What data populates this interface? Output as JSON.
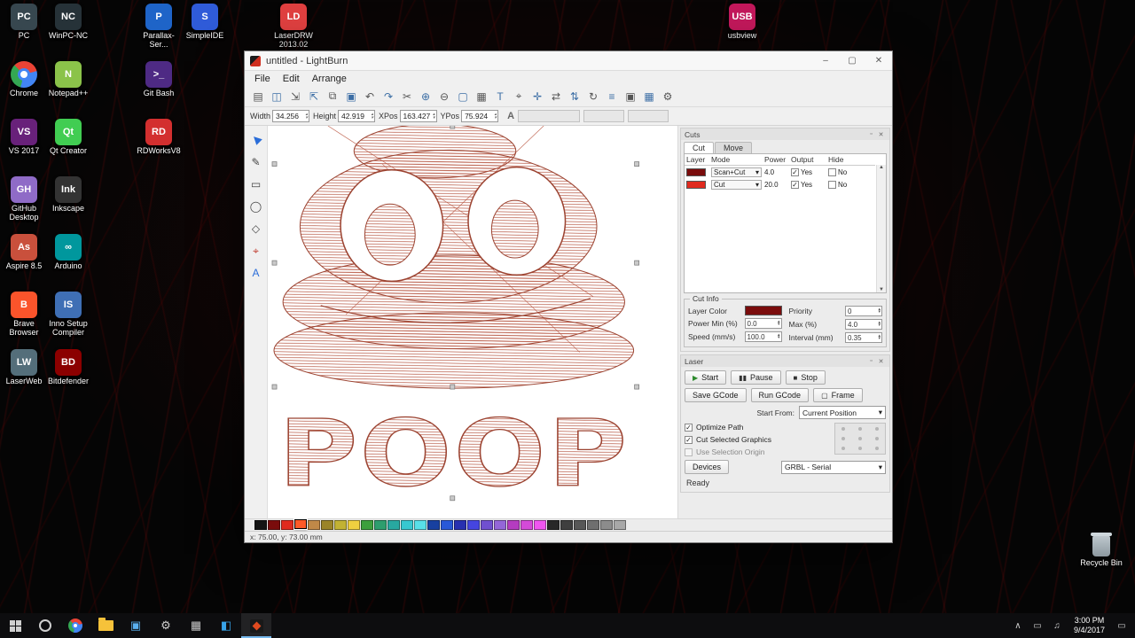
{
  "icons": {
    "chevron_down": "▾",
    "spin_up": "▴",
    "spin_down": "▾",
    "scroll_up": "▲",
    "scroll_down": "▼",
    "minimize": "–",
    "maximize": "▢",
    "close": "✕",
    "float": "▫"
  },
  "desktop": {
    "groups": [
      {
        "icons": [
          {
            "label": "PC",
            "abbr": "PC",
            "color": "#37474f"
          },
          {
            "label": "Chrome",
            "abbr": "",
            "color": "#e84335",
            "chrome": true
          },
          {
            "label": "VS 2017",
            "abbr": "VS",
            "color": "#68217a"
          },
          {
            "label": "GitHub Desktop",
            "abbr": "GH",
            "color": "#8f6bc7"
          },
          {
            "label": "Aspire 8.5",
            "abbr": "As",
            "color": "#c9503c"
          },
          {
            "label": "Brave Browser",
            "abbr": "B",
            "color": "#fb542b"
          },
          {
            "label": "LaserWeb",
            "abbr": "LW",
            "color": "#546e7a"
          }
        ]
      },
      {
        "icons": [
          {
            "label": "WinPC-NC",
            "abbr": "NC",
            "color": "#263238"
          },
          {
            "label": "Notepad++",
            "abbr": "N",
            "color": "#8bc34a"
          },
          {
            "label": "Qt Creator",
            "abbr": "Qt",
            "color": "#41cd52"
          },
          {
            "label": "Inkscape",
            "abbr": "Ink",
            "color": "#333333"
          },
          {
            "label": "Arduino",
            "abbr": "∞",
            "color": "#00979d"
          },
          {
            "label": "Inno Setup Compiler",
            "abbr": "IS",
            "color": "#3f6fb5"
          },
          {
            "label": "Bitdefender",
            "abbr": "BD",
            "color": "#8b0000"
          }
        ]
      },
      {
        "icons": [
          {
            "label": "Parallax-Ser...",
            "abbr": "P",
            "color": "#1e64c8"
          },
          {
            "label": "Git Bash",
            "abbr": ">_",
            "color": "#4e2a84"
          },
          {
            "label": "RDWorksV8",
            "abbr": "RD",
            "color": "#d32f2f"
          }
        ]
      },
      {
        "icons": [
          {
            "label": "SimpleIDE",
            "abbr": "S",
            "color": "#2f5bd8"
          }
        ]
      },
      {
        "icons": [
          {
            "label": "LaserDRW 2013.02",
            "abbr": "LD",
            "color": "#e04040"
          }
        ]
      },
      {
        "icons": [
          {
            "label": "usbview",
            "abbr": "USB",
            "color": "#c2185b"
          }
        ]
      }
    ],
    "recycle_bin_label": "Recycle Bin"
  },
  "window": {
    "title": "untitled - LightBurn",
    "menus": [
      "File",
      "Edit",
      "Arrange"
    ],
    "toolbar": [
      {
        "name": "open",
        "glyph": "▤"
      },
      {
        "name": "save",
        "glyph": "◫"
      },
      {
        "name": "import",
        "glyph": "⇲"
      },
      {
        "name": "export",
        "glyph": "⇱"
      },
      {
        "name": "copy",
        "glyph": "⧉"
      },
      {
        "name": "paste",
        "glyph": "▣"
      },
      {
        "name": "undo",
        "glyph": "↶"
      },
      {
        "name": "redo",
        "glyph": "↷"
      },
      {
        "name": "cut",
        "glyph": "✂"
      },
      {
        "name": "zoom-in",
        "glyph": "⊕"
      },
      {
        "name": "zoom-out",
        "glyph": "⊖"
      },
      {
        "name": "frame",
        "glyph": "▢"
      },
      {
        "name": "grid",
        "glyph": "▦"
      },
      {
        "name": "text",
        "glyph": "T"
      },
      {
        "name": "position-laser",
        "glyph": "⌖"
      },
      {
        "name": "move-machine",
        "glyph": "✛"
      },
      {
        "name": "mirror-h",
        "glyph": "⇄"
      },
      {
        "name": "mirror-v",
        "glyph": "⇅"
      },
      {
        "name": "rotate",
        "glyph": "↻"
      },
      {
        "name": "align",
        "glyph": "≡"
      },
      {
        "name": "group",
        "glyph": "▣"
      },
      {
        "name": "array",
        "glyph": "▦"
      },
      {
        "name": "settings",
        "glyph": "⚙"
      }
    ],
    "props": {
      "width_label": "Width",
      "width_value": "34.256",
      "height_label": "Height",
      "height_value": "42.919",
      "xpos_label": "XPos",
      "xpos_value": "163.427",
      "ypos_label": "YPos",
      "ypos_value": "75.924",
      "font_icon": "A"
    },
    "tools": [
      {
        "name": "select",
        "glyph": "▶",
        "color": "#2a6dd9",
        "rot": -135
      },
      {
        "name": "draw-lines",
        "glyph": "✎",
        "color": "#444",
        "rot": 0
      },
      {
        "name": "rectangle",
        "glyph": "▭",
        "color": "#444",
        "rot": 0
      },
      {
        "name": "ellipse",
        "glyph": "◯",
        "color": "#444",
        "rot": 0
      },
      {
        "name": "polygon",
        "glyph": "◇",
        "color": "#444",
        "rot": 0
      },
      {
        "name": "position-laser",
        "glyph": "⌖",
        "color": "#c0392b",
        "rot": 0
      },
      {
        "name": "text",
        "glyph": "A",
        "color": "#2a6dd9",
        "rot": 0
      }
    ],
    "cuts": {
      "title": "Cuts",
      "tabs": [
        "Cut",
        "Move"
      ],
      "columns": [
        "Layer",
        "Mode",
        "Power",
        "Output",
        "Hide"
      ],
      "layers": [
        {
          "color": "#7a0c0c",
          "mode": "Scan+Cut",
          "power": "4.0",
          "output_label": "Yes",
          "output_checked": true,
          "hide_label": "No",
          "hide_checked": false
        },
        {
          "color": "#e02a1e",
          "mode": "Cut",
          "power": "20.0",
          "output_label": "Yes",
          "output_checked": true,
          "hide_label": "No",
          "hide_checked": false
        }
      ],
      "cut_info": {
        "title": "Cut Info",
        "layer_color_label": "Layer Color",
        "layer_color": "#7a0c0c",
        "rows_left": [
          {
            "label": "Power Min (%)",
            "value": "0.0"
          },
          {
            "label": "Speed (mm/s)",
            "value": "100.0"
          }
        ],
        "rows_right": [
          {
            "label": "Priority",
            "value": "0"
          },
          {
            "label": "Max (%)",
            "value": "4.0"
          },
          {
            "label": "Interval (mm)",
            "value": "0.35"
          }
        ]
      }
    },
    "laser": {
      "title": "Laser",
      "start_label": "Start",
      "pause_label": "Pause",
      "stop_label": "Stop",
      "start_icon": "▶",
      "pause_icon": "▮▮",
      "stop_icon": "■",
      "save_gcode_label": "Save GCode",
      "run_gcode_label": "Run GCode",
      "frame_label": "Frame",
      "frame_icon": "▢",
      "start_from_label": "Start From:",
      "start_from_value": "Current Position",
      "checks": [
        {
          "label": "Optimize Path",
          "checked": true,
          "disabled": false
        },
        {
          "label": "Cut Selected Graphics",
          "checked": true,
          "disabled": false
        },
        {
          "label": "Use Selection Origin",
          "checked": false,
          "disabled": true
        }
      ],
      "devices_label": "Devices",
      "device_value": "GRBL - Serial",
      "status": "Ready"
    },
    "palette": {
      "colors": [
        "#141414",
        "#7a0c0c",
        "#e02a1e",
        "#ff5a28",
        "#c08848",
        "#9a8428",
        "#c2b233",
        "#f0d040",
        "#3da03d",
        "#2e9e6e",
        "#28a8a0",
        "#38c8d0",
        "#58e0e8",
        "#1840a0",
        "#2858d8",
        "#2830b0",
        "#4545e0",
        "#7050d0",
        "#9466d8",
        "#b43cc0",
        "#d44ad8",
        "#f055f0",
        "#282828",
        "#3f3f3f",
        "#575757",
        "#6f6f6f",
        "#8c8c8c",
        "#a8a8a8"
      ],
      "selected": 3
    },
    "statusbar": "x: 75.00, y: 73.00 mm"
  },
  "canvas": {
    "text": "POOP"
  },
  "taskbar": {
    "pinned": [
      {
        "name": "chrome",
        "kind": "chrome"
      },
      {
        "name": "file-explorer",
        "kind": "folder"
      },
      {
        "name": "photos",
        "glyph": "▣",
        "color": "#5ab0f0"
      },
      {
        "name": "settings",
        "glyph": "⚙",
        "color": "#d0d0d0"
      },
      {
        "name": "store",
        "glyph": "▦",
        "color": "#c8c8c8"
      },
      {
        "name": "vscode",
        "glyph": "◧",
        "color": "#38a3e8"
      },
      {
        "name": "lightburn",
        "kind": "lightburn",
        "active": true
      }
    ],
    "tray": [
      {
        "name": "chevron-up",
        "glyph": "∧"
      },
      {
        "name": "display",
        "glyph": "▭"
      },
      {
        "name": "volume",
        "glyph": "♫"
      }
    ],
    "clock_time": "3:00 PM",
    "clock_date": "9/4/2017"
  }
}
